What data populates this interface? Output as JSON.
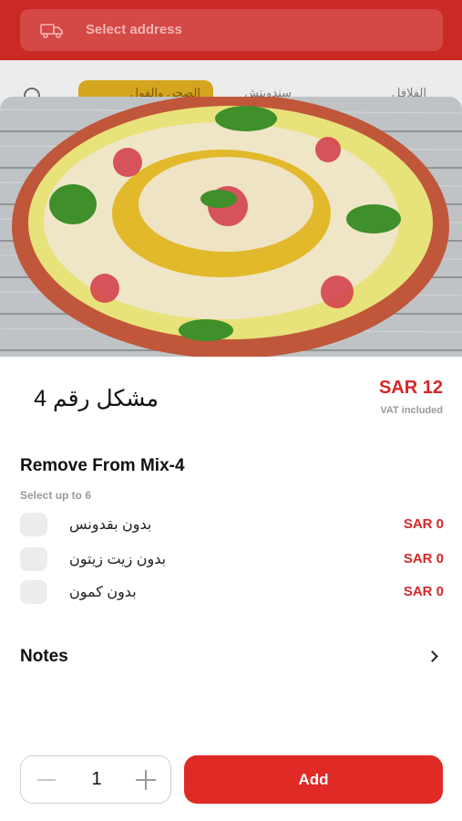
{
  "address_bar": {
    "placeholder": "Select address",
    "icon": "delivery-truck-icon"
  },
  "background_tabs": {
    "tab_right": "الفلافل",
    "tab_middle": "سندويتش",
    "tab_active": "الصحن والفول"
  },
  "item": {
    "name": "مشكل رقم  4",
    "price": "SAR 12",
    "vat_note": "VAT included"
  },
  "modifier_group": {
    "title": "Remove From Mix-4",
    "subtitle": "Select up to 6",
    "options": [
      {
        "label": "بدون بقدونس",
        "price": "SAR 0"
      },
      {
        "label": "بدون زيت زيتون",
        "price": "SAR 0"
      },
      {
        "label": "بدون كمون",
        "price": "SAR 0"
      }
    ]
  },
  "notes": {
    "label": "Notes"
  },
  "quantity": {
    "value": "1"
  },
  "actions": {
    "add_label": "Add"
  },
  "colors": {
    "brand_red": "#e02a26",
    "price_red": "#d8262a",
    "accent_gold": "#d4a51e"
  }
}
